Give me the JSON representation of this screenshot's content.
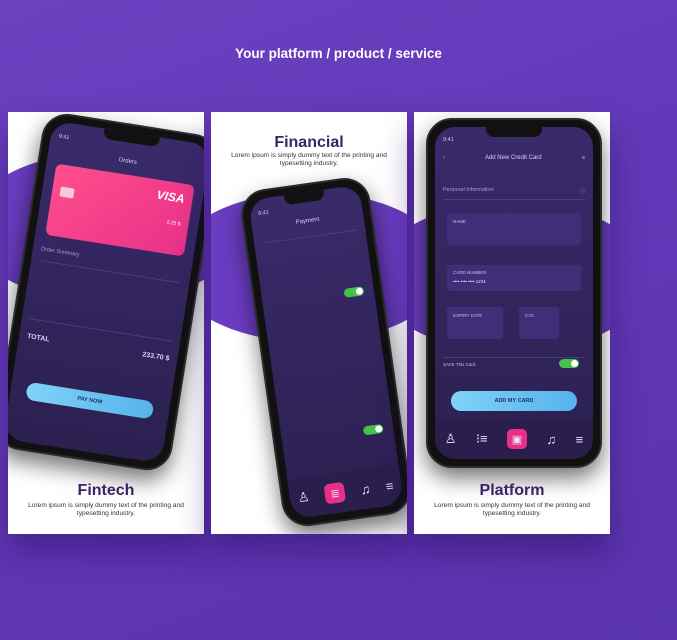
{
  "headline": "Your platform / product / service",
  "panels": [
    {
      "title": "Fintech",
      "desc": "Lorem ipsum is simply dummy text of the printing and typesetting industry.",
      "phone": {
        "time": "9:41",
        "title": "Orders",
        "card_brand": "VISA",
        "card_amount": "2.25 $",
        "section": "Order Summary",
        "total_label": "TOTAL",
        "total_value": "233.70 $",
        "button": "PAY NOW"
      }
    },
    {
      "title": "Financial",
      "desc": "Lorem ipsum is simply dummy text of the printing and typesetting industry.",
      "phone": {
        "time": "9:41",
        "title": "Payment"
      }
    },
    {
      "title": "Platform",
      "desc": "Lorem ipsum is simply dummy text of the printing and typesetting industry.",
      "phone": {
        "time": "9:41",
        "title": "Add New Credit Card",
        "section": "Personal Information",
        "name_label": "NAME",
        "card_number_label": "CARD NUMBER",
        "card_number_value": "•••• •••• •••• 1234",
        "expiry_label": "EXPIRY DATE",
        "cvc_label": "CVC",
        "save_label": "SAVE This Card",
        "button": "ADD MY CARD"
      }
    }
  ],
  "tab_icons": [
    "user-icon",
    "list-icon",
    "card-icon",
    "bell-icon",
    "menu-icon"
  ],
  "colors": {
    "background": "#6238b8",
    "accent_pink": "#e8308a",
    "button_blue": "#6ac3f2",
    "toggle_green": "#44c24a"
  }
}
